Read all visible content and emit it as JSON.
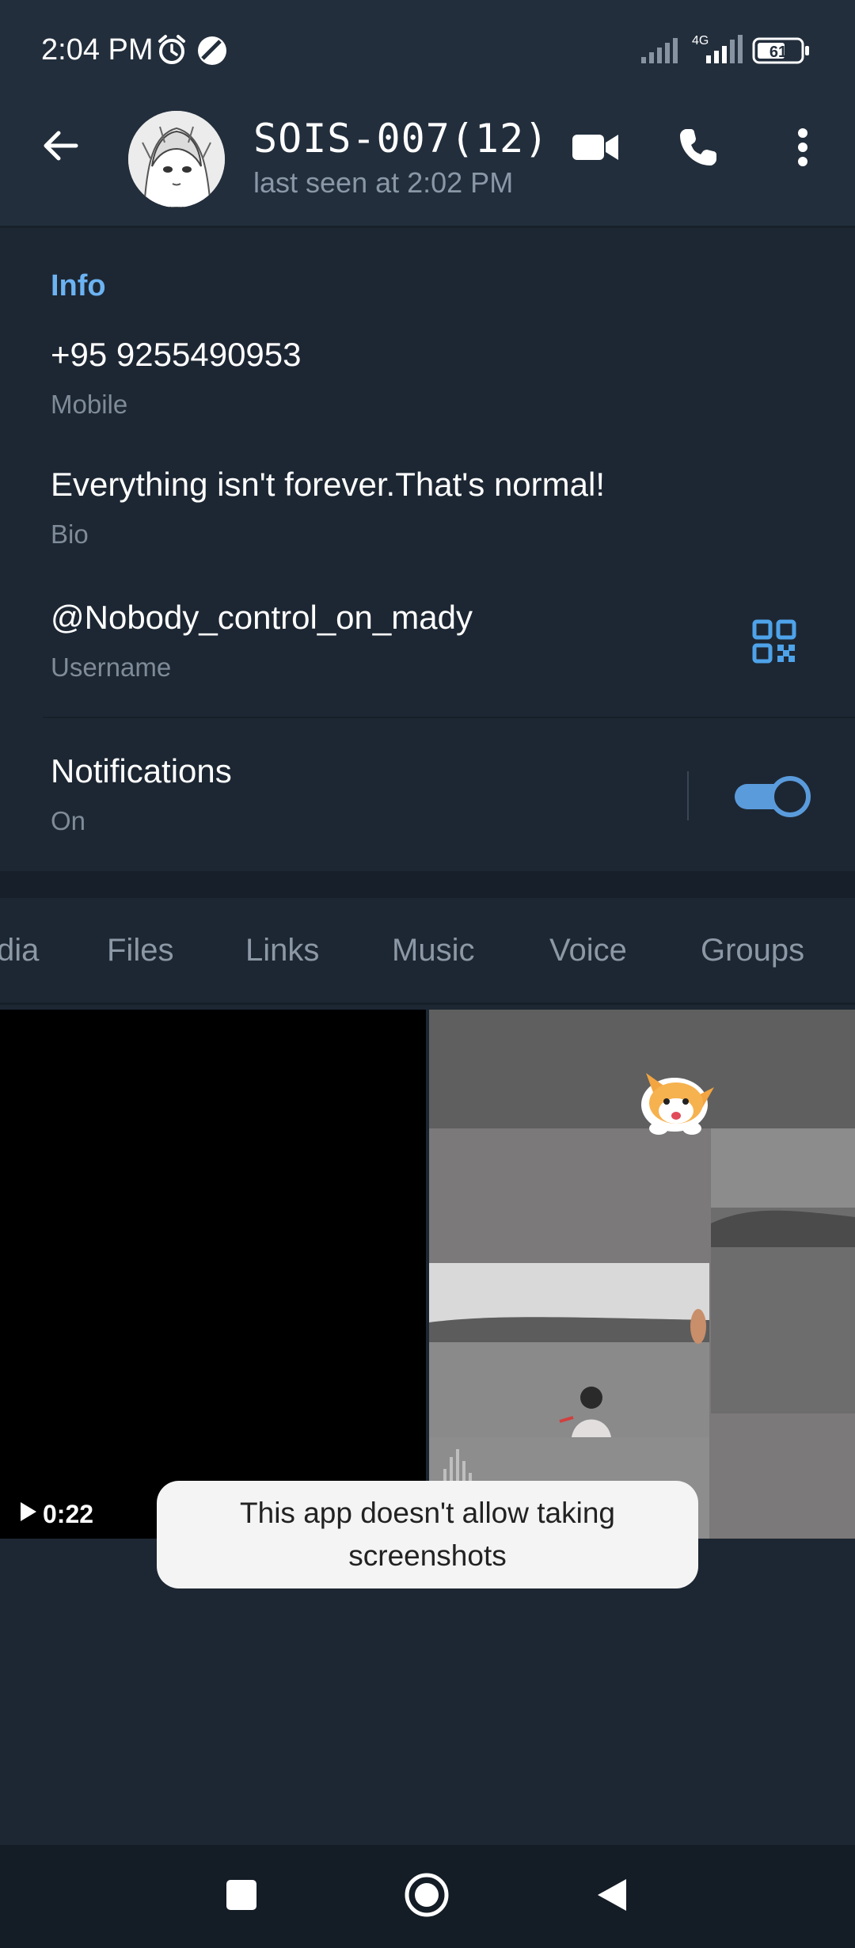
{
  "status_bar": {
    "time": "2:04 PM",
    "network": "4G",
    "battery": "61"
  },
  "header": {
    "name": "SOIS-007(12)",
    "status": "last seen at 2:02 PM"
  },
  "info": {
    "section_title": "Info",
    "phone": "+95 9255490953",
    "phone_label": "Mobile",
    "bio": "Everything isn't forever.That's normal!",
    "bio_label": "Bio",
    "username": "@Nobody_control_on_mady",
    "username_label": "Username",
    "notifications": "Notifications",
    "notifications_state": "On",
    "notifications_enabled": true
  },
  "tabs": [
    "dia",
    "Files",
    "Links",
    "Music",
    "Voice",
    "Groups"
  ],
  "media": {
    "video_duration": "0:22"
  },
  "toast": {
    "line1": "This app doesn't allow taking",
    "line2": "screenshots"
  },
  "colors": {
    "accent": "#6cb3f2",
    "toggle": "#5a9bdc",
    "background": "#1d2733",
    "header": "#222e3c"
  },
  "icons": {
    "alarm": "alarm-icon",
    "dnd": "dnd-icon",
    "back": "arrow-left-icon",
    "video": "video-call-icon",
    "call": "phone-icon",
    "more": "more-vert-icon",
    "qr": "qr-code-icon"
  }
}
